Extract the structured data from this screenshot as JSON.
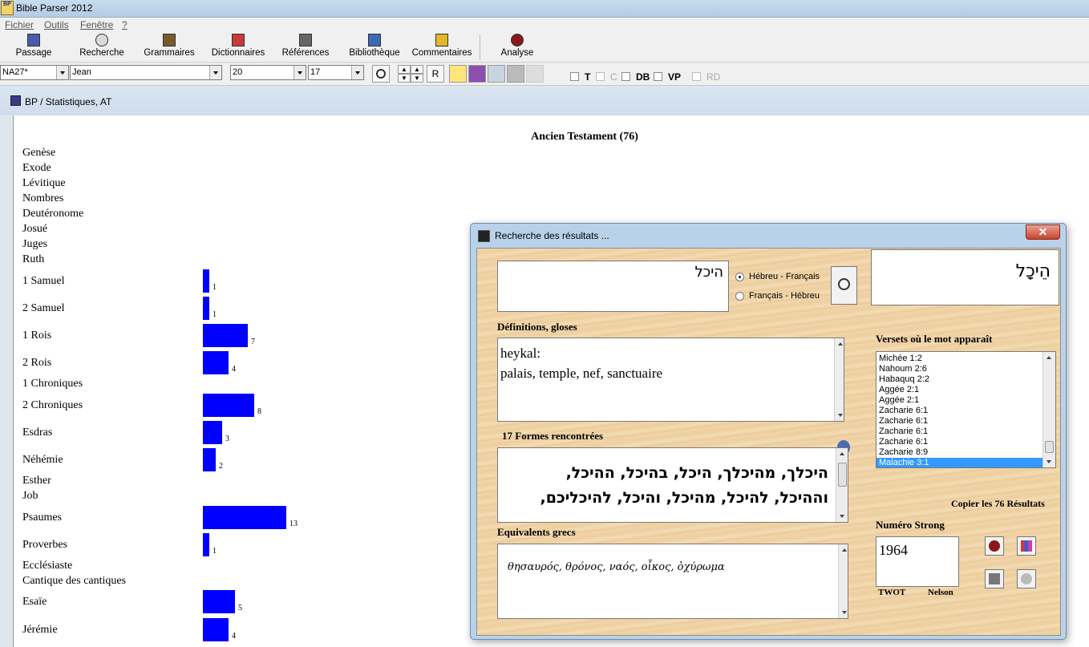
{
  "window": {
    "title": "Bible Parser 2012",
    "icon_text": "BP"
  },
  "menu": [
    {
      "label": "Fichier"
    },
    {
      "label": "Outils"
    },
    {
      "label": "Fenêtre"
    },
    {
      "label": "?"
    }
  ],
  "toolbar": {
    "buttons": [
      {
        "label": "Passage",
        "icon": "passage-icon"
      },
      {
        "label": "Recherche",
        "icon": "search-icon"
      },
      {
        "label": "Grammaires",
        "icon": "grammar-books-icon"
      },
      {
        "label": "Dictionnaires",
        "icon": "dictionary-icon"
      },
      {
        "label": "Références",
        "icon": "references-icon"
      },
      {
        "label": "Bibliothèque",
        "icon": "library-icon"
      },
      {
        "label": "Commentaires",
        "icon": "commentary-icon"
      },
      {
        "label": "Analyse",
        "icon": "analysis-icon"
      }
    ]
  },
  "selectors": {
    "version": "NA27*",
    "book": "Jean",
    "chapter": "20",
    "verse": "17",
    "r_label": "R"
  },
  "checkboxes": [
    {
      "label": "T",
      "enabled": true
    },
    {
      "label": "C",
      "enabled": false
    },
    {
      "label": "DB",
      "enabled": true
    },
    {
      "label": "VP",
      "enabled": true
    },
    {
      "label": "RD",
      "enabled": false
    }
  ],
  "child_window": {
    "title": "BP / Statistiques, AT"
  },
  "chart_data": {
    "type": "bar",
    "orientation": "horizontal",
    "title": "Ancien Testament (76)",
    "color": "#0000ff",
    "categories": [
      "Genèse",
      "Exode",
      "Lévitique",
      "Nombres",
      "Deutéronome",
      "Josué",
      "Juges",
      "Ruth",
      "1 Samuel",
      "2 Samuel",
      "1 Rois",
      "2 Rois",
      "1 Chroniques",
      "2 Chroniques",
      "Esdras",
      "Néhémie",
      "Esther",
      "Job",
      "Psaumes",
      "Proverbes",
      "Ecclésiaste",
      "Cantique des cantiques",
      "Esaïe",
      "Jérémie"
    ],
    "values": [
      0,
      0,
      0,
      0,
      0,
      0,
      0,
      0,
      1,
      1,
      7,
      4,
      0,
      8,
      3,
      2,
      0,
      0,
      13,
      1,
      0,
      0,
      5,
      4
    ]
  },
  "dialog": {
    "title": "Recherche des résultats ...",
    "close_label": "x",
    "search_text": "היכל",
    "radio_options": [
      {
        "label": "Hébreu - Français",
        "checked": true
      },
      {
        "label": "Français - Hébreu",
        "checked": false
      }
    ],
    "word_display": "הֵיכָל",
    "definitions_label": "Définitions, gloses",
    "definitions_text_1": "heykal:",
    "definitions_text_2": "palais, temple, nef, sanctuaire",
    "forms_label": "17 Formes rencontrées",
    "forms_line_1": "היכלך, מהיכלך, היכל, בהיכל, ההיכל,",
    "forms_line_2": "וההיכל, להיכל, מהיכל, והיכל, להיכליכם,",
    "verses_label": "Versets où le mot apparaît",
    "verses": [
      "Michée 1:2",
      "Nahoum 2:6",
      "Habaquq 2:2",
      "Aggée 2:1",
      "Aggée 2:1",
      "Zacharie 6:1",
      "Zacharie 6:1",
      "Zacharie 6:1",
      "Zacharie 6:1",
      "Zacharie 8:9",
      "Malachie 3:1"
    ],
    "selected_verse_index": 10,
    "copy_label": "Copier les 76 Résultats",
    "greek_label": "Equivalents grecs",
    "greek_text": "θησαυρός, θρόνος, ναός, οἶκος, ὀχύρωμα",
    "strong_label": "Numéro Strong",
    "strong_number": "1964",
    "twot_label": "TWOT",
    "nelson_label": "Nelson"
  }
}
